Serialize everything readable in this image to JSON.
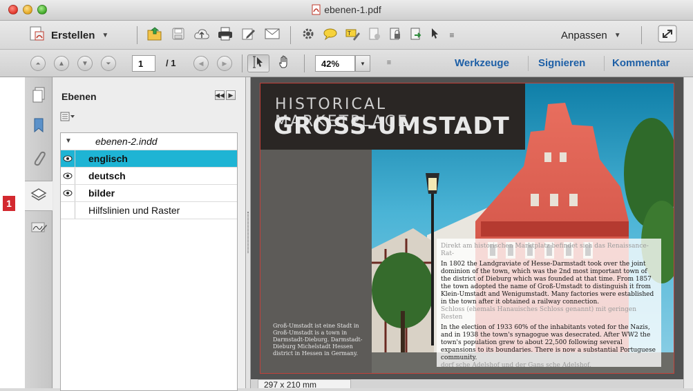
{
  "window": {
    "title": "ebenen-1.pdf"
  },
  "toolbar": {
    "create_label": "Erstellen",
    "customize_label": "Anpassen"
  },
  "nav": {
    "page_current": "1",
    "page_total": "/ 1",
    "zoom": "42%",
    "links": [
      "Werkzeuge",
      "Signieren",
      "Kommentar"
    ]
  },
  "marker": "1",
  "layers_panel": {
    "title": "Ebenen",
    "document": "ebenen-2.indd",
    "layers": [
      {
        "name": "englisch",
        "visible": true,
        "selected": true
      },
      {
        "name": "deutsch",
        "visible": true,
        "selected": false
      },
      {
        "name": "bilder",
        "visible": true,
        "selected": false
      },
      {
        "name": "Hilfslinien und Raster",
        "visible": false,
        "selected": false
      }
    ]
  },
  "document": {
    "heading_line1": "HISTORICAL  MARKETPLACE",
    "heading_line2": "GROSS-UMSTADT",
    "caption": "Groß-Umstadt ist eine Stadt in Groß-Umstadt is a town in Darmstadt-Dieburg. Darmstadt-Dieburg Michelstadt Hessen district in Hessen in Germany.",
    "body_ghost_1": "Direkt am historischen Marktplatz befindet sich das Renaissance-Rat-",
    "body_p1": "In 1802 the Landgraviate of Hesse-Darmstadt took over the joint dominion of the town, which was the 2nd most important town of the district of Dieburg which was founded at that time. From 1857 the town adopted the name of Groß-Umstadt to distinguish it from Klein-Umstadt and Wenigumstadt. Many factories were established in the town after it obtained a railway connection.",
    "body_ghost_2": "Schloss (ehemals Hanauisches Schloss genannt) mit geringen Resten",
    "body_p2": "In the election of 1933 60% of the inhabitants voted for the Nazis, and in 1938 the town's synagogue was desecrated. After WW2 the town's population grew to about 22,500 following several expansions to its boundaries. There is now a substantial Portuguese community.",
    "body_ghost_3": "dorf sche Adelshof und der Gans sche Adelshof."
  },
  "status": {
    "page_size": "297 x 210 mm"
  },
  "colors": {
    "selection": "#1eb4d4",
    "link": "#1d5fa6",
    "marker": "#d3292f"
  }
}
